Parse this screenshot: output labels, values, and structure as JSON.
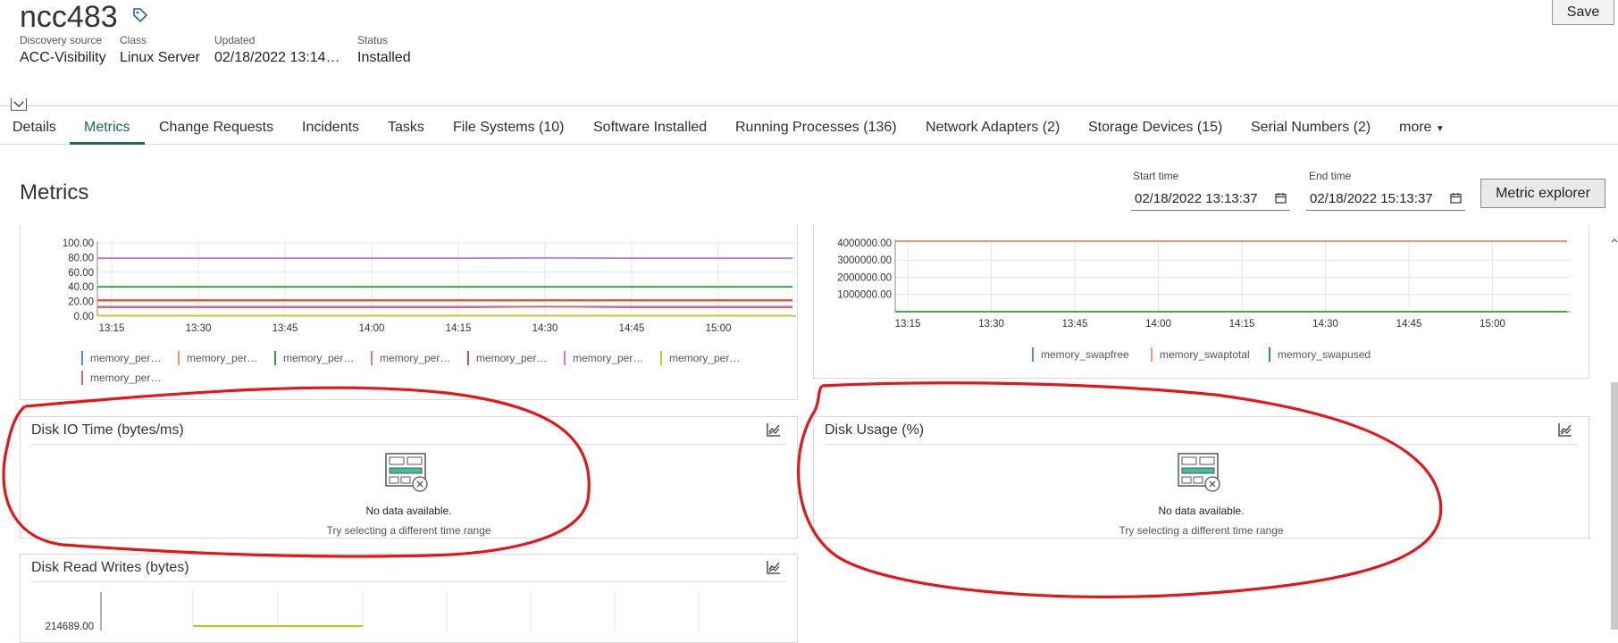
{
  "header": {
    "title": "ncc483",
    "save_label": "Save",
    "fields": [
      {
        "label": "Discovery source",
        "value": "ACC-Visibility"
      },
      {
        "label": "Class",
        "value": "Linux Server"
      },
      {
        "label": "Updated",
        "value": "02/18/2022 13:14…"
      },
      {
        "label": "Status",
        "value": "Installed"
      }
    ]
  },
  "tabs": [
    {
      "label": "Details"
    },
    {
      "label": "Metrics"
    },
    {
      "label": "Change Requests"
    },
    {
      "label": "Incidents"
    },
    {
      "label": "Tasks"
    },
    {
      "label": "File Systems (10)"
    },
    {
      "label": "Software Installed"
    },
    {
      "label": "Running Processes (136)"
    },
    {
      "label": "Network Adapters (2)"
    },
    {
      "label": "Storage Devices (15)"
    },
    {
      "label": "Serial Numbers (2)"
    },
    {
      "label": "more"
    }
  ],
  "metrics": {
    "heading": "Metrics",
    "start_label": "Start time",
    "start_value": "02/18/2022 13:13:37",
    "end_label": "End time",
    "end_value": "02/18/2022 15:13:37",
    "explorer_label": "Metric explorer"
  },
  "cards": {
    "disk_io": {
      "title": "Disk IO Time (bytes/ms)",
      "no_data": "No data available.",
      "hint": "Try selecting a different time range"
    },
    "disk_usage": {
      "title": "Disk Usage (%)",
      "no_data": "No data available.",
      "hint": "Try selecting a different time range"
    },
    "disk_rw": {
      "title": "Disk Read Writes (bytes)",
      "first_tick": "214689.00"
    }
  },
  "colors": {
    "accent": "#1a6b5a",
    "annotation": "#e3161b"
  },
  "chart_data": [
    {
      "type": "line",
      "x": [
        "13:15",
        "13:30",
        "13:45",
        "14:00",
        "14:15",
        "14:30",
        "14:45",
        "15:00"
      ],
      "yticks": [
        "0.00",
        "20.00",
        "40.00",
        "60.00",
        "80.00",
        "100.00"
      ],
      "ylim": [
        0,
        100
      ],
      "grid": true,
      "series": [
        {
          "name": "memory_per…",
          "color": "#4a90d9",
          "values": [
            0.5,
            0.5,
            0.5,
            0.5,
            0.5,
            0.5,
            0.5,
            0.5
          ]
        },
        {
          "name": "memory_per…",
          "color": "#f39c6b",
          "values": [
            21,
            21,
            21,
            21,
            21,
            21,
            21,
            21
          ]
        },
        {
          "name": "memory_per…",
          "color": "#2e9b3e",
          "values": [
            40,
            40,
            40,
            40,
            40,
            40,
            40,
            40
          ]
        },
        {
          "name": "memory_per…",
          "color": "#b77ae8",
          "values": [
            79,
            79,
            79,
            79,
            79,
            79.5,
            79,
            79
          ]
        },
        {
          "name": "memory_per…",
          "color": "#d94a4a",
          "values": [
            22,
            22,
            22,
            22,
            22,
            22,
            22,
            22
          ]
        },
        {
          "name": "memory_per…",
          "color": "#c77ad9",
          "values": [
            13,
            13,
            13,
            13,
            13,
            13,
            13,
            13
          ]
        },
        {
          "name": "memory_per…",
          "color": "#c8c81a",
          "values": [
            0.5,
            0.5,
            0.5,
            0.5,
            0.5,
            0.5,
            0.5,
            0.5
          ]
        },
        {
          "name": "memory_per…",
          "color": "#e06868",
          "values": [
            12,
            12,
            12,
            12,
            12,
            13,
            12,
            12
          ]
        }
      ]
    },
    {
      "type": "line",
      "x": [
        "13:15",
        "13:30",
        "13:45",
        "14:00",
        "14:15",
        "14:30",
        "14:45",
        "15:00"
      ],
      "yticks": [
        "1000000.00",
        "2000000.00",
        "3000000.00",
        "4000000.00"
      ],
      "ylim": [
        0,
        4100000
      ],
      "grid": true,
      "series": [
        {
          "name": "memory_swapfree",
          "color": "#4a90d9",
          "values": [
            4100000,
            4100000,
            4100000,
            4100000,
            4100000,
            4100000,
            4100000,
            4100000
          ]
        },
        {
          "name": "memory_swaptotal",
          "color": "#f39c6b",
          "values": [
            4100000,
            4100000,
            4100000,
            4100000,
            4100000,
            4100000,
            4100000,
            4100000
          ]
        },
        {
          "name": "memory_swapused",
          "color": "#2e9b3e",
          "values": [
            0,
            0,
            0,
            0,
            0,
            0,
            0,
            0
          ]
        }
      ]
    }
  ]
}
